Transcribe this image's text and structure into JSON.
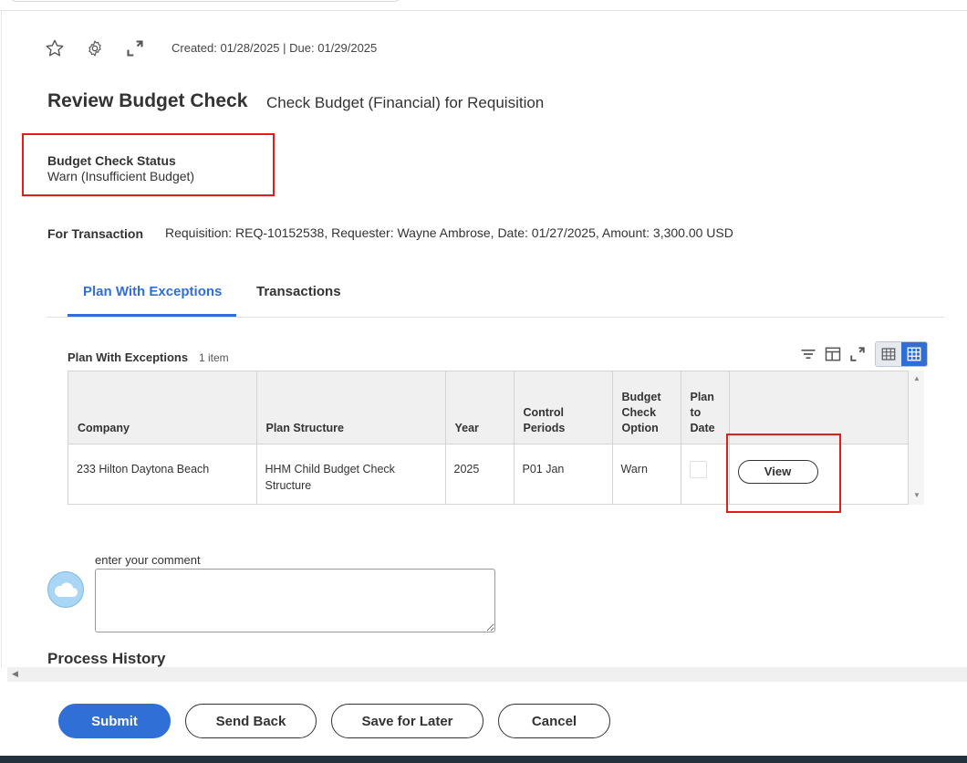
{
  "header": {
    "icons": [
      "star-icon",
      "gear-icon",
      "expand-icon"
    ],
    "meta": "Created: 01/28/2025 | Due: 01/29/2025"
  },
  "page": {
    "title": "Review Budget Check",
    "subtitle": "Check Budget (Financial) for Requisition"
  },
  "status": {
    "label": "Budget Check Status",
    "value": "Warn (Insufficient Budget)"
  },
  "transaction": {
    "label": "For Transaction",
    "value": "Requisition: REQ-10152538, Requester: Wayne Ambrose, Date: 01/27/2025, Amount: 3,300.00 USD"
  },
  "tabs": [
    {
      "label": "Plan With Exceptions",
      "active": true
    },
    {
      "label": "Transactions",
      "active": false
    }
  ],
  "grid": {
    "title": "Plan With Exceptions",
    "count": "1 item",
    "columns": [
      "Company",
      "Plan Structure",
      "Year",
      "Control Periods",
      "Budget Check Option",
      "Plan to Date",
      ""
    ],
    "rows": [
      {
        "company": "233 Hilton Daytona Beach",
        "plan_structure": "HHM Child Budget Check Structure",
        "year": "2025",
        "control_periods": "P01 Jan",
        "budget_check_option": "Warn",
        "plan_to_date": false,
        "action": "View"
      }
    ]
  },
  "comment": {
    "label": "enter your comment",
    "value": ""
  },
  "process_history": "Process History",
  "footer": {
    "submit": "Submit",
    "send_back": "Send Back",
    "save_for_later": "Save for Later",
    "cancel": "Cancel"
  },
  "colors": {
    "accent": "#2f6fd6",
    "highlight_box": "#e01e1e"
  }
}
